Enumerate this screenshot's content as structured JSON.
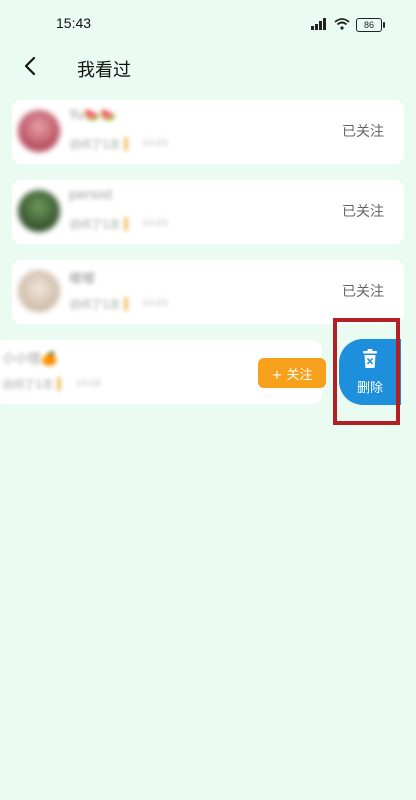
{
  "status_bar": {
    "time": "15:43",
    "battery": "86"
  },
  "header": {
    "title": "我看过"
  },
  "list": [
    {
      "name": "Yu🍉🍉",
      "followed": true,
      "status": "已关注",
      "sub": "访问了1次",
      "meta": "10:00"
    },
    {
      "name": "persist",
      "followed": true,
      "status": "已关注",
      "sub": "访问了1次",
      "meta": "10:00"
    },
    {
      "name": "嘟嘟",
      "followed": true,
      "status": "已关注",
      "sub": "访问了1次",
      "meta": "10:00"
    },
    {
      "name": "小小怪🍊",
      "followed": false,
      "sub": "访问了1次",
      "meta": "10:00"
    }
  ],
  "actions": {
    "follow_label": "+ 关注",
    "delete_label": "删除"
  },
  "colors": {
    "follow": "#f7a01b",
    "delete": "#1e8fdc",
    "highlight": "#b41f24",
    "background": "#eafcf2"
  }
}
